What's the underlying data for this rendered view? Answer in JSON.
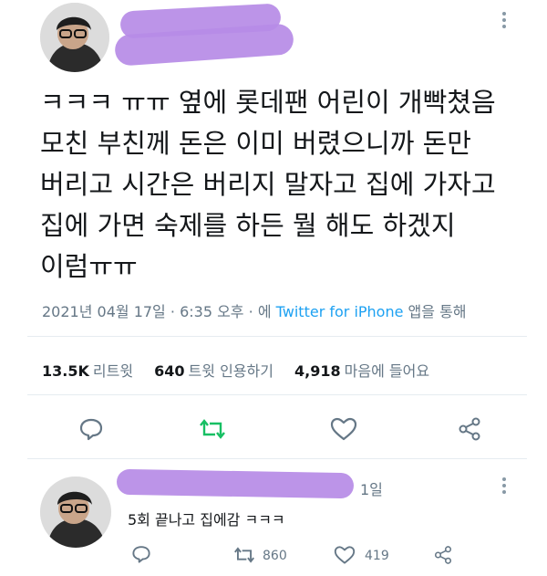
{
  "tweet": {
    "text_lines": [
      "ㅋㅋㅋ ㅠㅠ 옆에 롯데팬 어린이 개빡쳤음",
      "모친 부친께 돈은 이미 버렸으니까 돈만",
      "버리고 시간은 버리지 말자고 집에 가자고",
      "집에 가면 숙제를 하든 뭘 해도 하겠지",
      "이럼ㅠㅠ"
    ],
    "date": "2021년 04월 17일",
    "time": "6:35 오후",
    "via_prefix": "에",
    "via_link": "Twitter for iPhone",
    "via_suffix": "앱을 통해",
    "retweets_count": "13.5K",
    "retweets_label": "리트윗",
    "quotes_count": "640",
    "quotes_label": "트윗 인용하기",
    "likes_count": "4,918",
    "likes_label": "마음에 들어요"
  },
  "reply": {
    "time": "1일",
    "text": "5회 끝나고 집에감 ㅋㅋㅋ",
    "retweets": "860",
    "likes": "419"
  },
  "icons": {
    "reply": "reply-icon",
    "retweet": "retweet-icon",
    "like": "like-icon",
    "share": "share-icon",
    "more": "more-icon"
  },
  "colors": {
    "retweet_green": "#17bf63",
    "link_blue": "#1da1f2",
    "muted": "#657786",
    "redaction": "#b68be6"
  }
}
